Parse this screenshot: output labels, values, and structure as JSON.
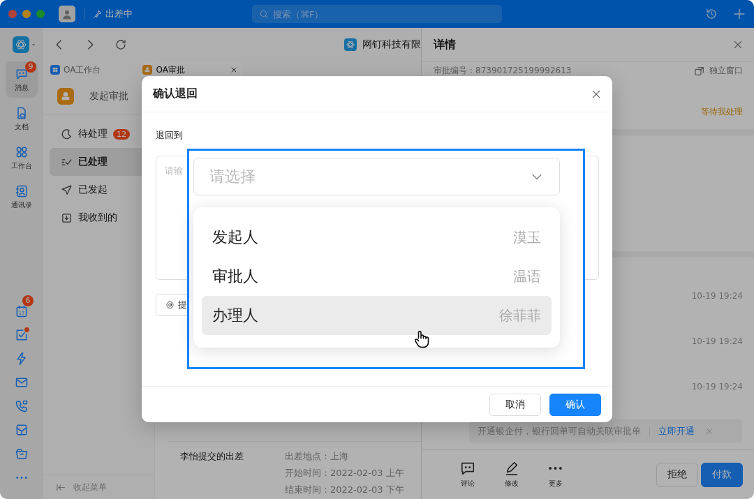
{
  "titlebar": {
    "status": "出差中",
    "search": {
      "placeholder": "搜索（⌘F）"
    }
  },
  "rail": {
    "items": [
      {
        "label": "消息",
        "badge": "9",
        "selected": true
      },
      {
        "label": "文档",
        "selected": false
      },
      {
        "label": "工作台",
        "selected": false
      },
      {
        "label": "通讯录",
        "selected": false
      }
    ],
    "tools": [
      {
        "date": "17",
        "badge": "6",
        "dot": false
      },
      {
        "dot": true
      },
      {
        "dot": false
      },
      {
        "dot": false
      },
      {
        "dot": false
      },
      {
        "dot": false
      },
      {
        "dot": false
      },
      {
        "dot": false
      }
    ]
  },
  "toolbar": {
    "company": "网钉科技有限"
  },
  "tabs": [
    {
      "label": "OA工作台",
      "selected": false,
      "closable": false
    },
    {
      "label": "OA审批",
      "selected": true,
      "closable": true
    }
  ],
  "nav": {
    "title": "发起审批",
    "items": [
      {
        "label": "待处理",
        "badge": "12",
        "selected": false
      },
      {
        "label": "已处理",
        "selected": true
      },
      {
        "label": "已发起",
        "selected": false
      },
      {
        "label": "我收到的",
        "selected": false
      }
    ],
    "collapse": "收起菜单"
  },
  "content": {
    "rows": [
      {
        "title": "李怡提交的出差",
        "fields": [
          "出差地点：上海",
          "开始时间：2022-02-03 上午",
          "结束时间：2022-02-03 下午"
        ]
      }
    ]
  },
  "detail": {
    "title": "详情",
    "serial": "审批编号：873901725199992613",
    "popout": "独立窗口",
    "status": "等待我处理",
    "times": [
      "10-19 19:24",
      "10-19 19:24",
      "10-19 19:24"
    ],
    "banner": {
      "text": "开通银企付，银行回单可自动关联审批单",
      "link": "立即开通"
    },
    "actions": [
      {
        "label": "评论"
      },
      {
        "label": "修改"
      },
      {
        "label": "更多"
      }
    ],
    "buttons": [
      {
        "label": "拒绝",
        "primary": false
      },
      {
        "label": "付款",
        "primary": true
      }
    ]
  },
  "modal": {
    "title": "确认退回",
    "label": "退回到",
    "textarea": {
      "placeholder": "请输"
    },
    "mention": "提",
    "select": {
      "placeholder": "请选择"
    },
    "options": [
      {
        "name": "发起人",
        "person": "漠玉",
        "selected": false
      },
      {
        "name": "审批人",
        "person": "温语",
        "selected": false
      },
      {
        "name": "办理人",
        "person": "徐菲菲",
        "selected": true
      }
    ],
    "buttons": [
      {
        "label": "取消",
        "primary": false
      },
      {
        "label": "确认",
        "primary": true
      }
    ]
  }
}
